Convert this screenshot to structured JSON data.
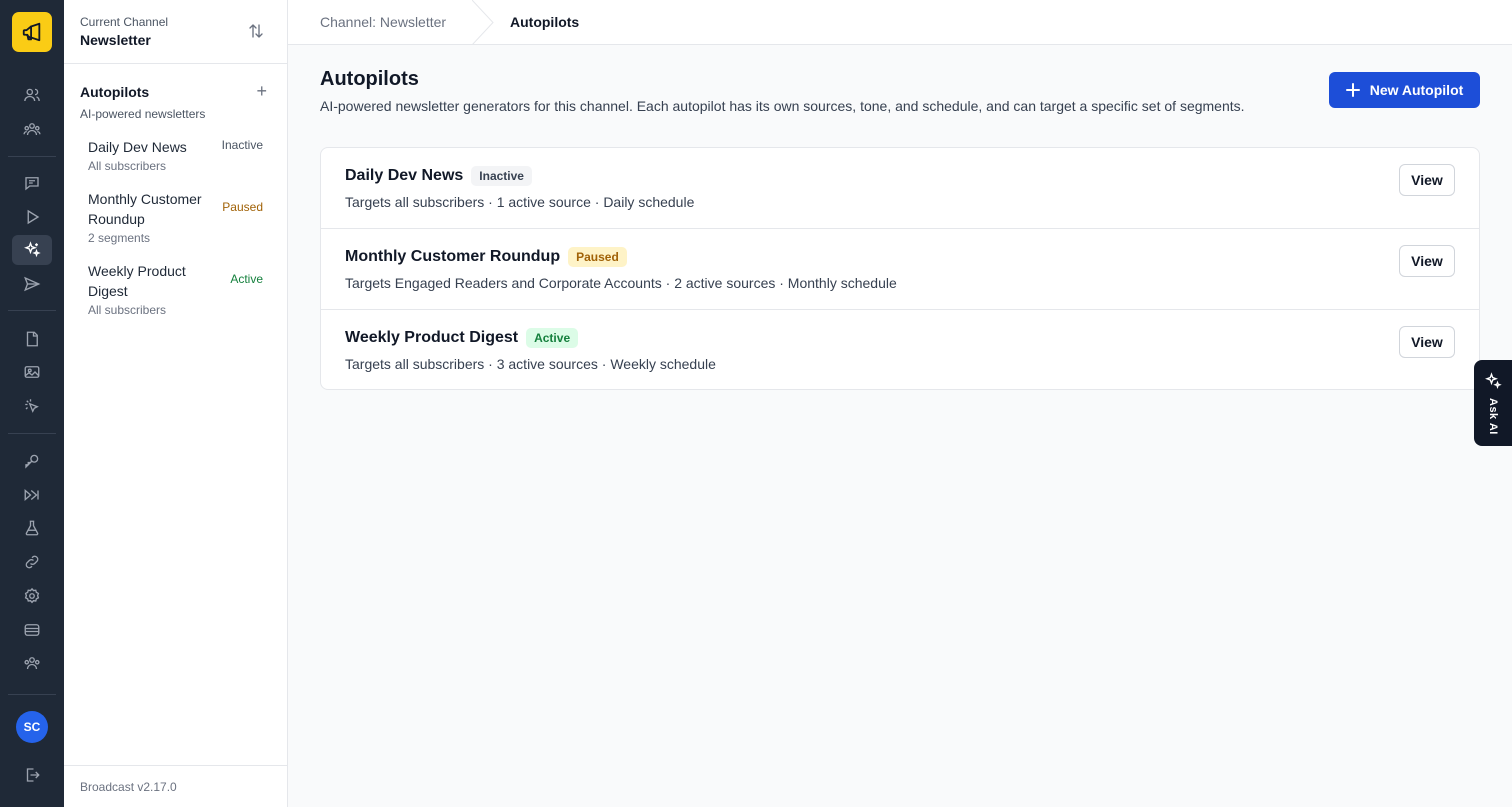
{
  "rail": {
    "logo_icon": "megaphone-icon",
    "avatar_initials": "SC",
    "icons": [
      "subscribers-icon",
      "segments-icon",
      "broadcasts-icon",
      "sequences-icon",
      "autopilots-icon",
      "transactional-icon",
      "templates-icon",
      "media-icon",
      "tracking-icon",
      "api-keys-icon",
      "webhooks-icon",
      "lab-icon",
      "integrations-icon",
      "settings-icon",
      "database-icon",
      "users-icon",
      "logout-icon"
    ]
  },
  "sidebar": {
    "channel_label": "Current Channel",
    "channel_name": "Newsletter",
    "section_title": "Autopilots",
    "section_subtitle": "AI-powered newsletters",
    "items": [
      {
        "name": "Daily Dev News",
        "meta": "All subscribers",
        "status": "Inactive"
      },
      {
        "name": "Monthly Customer Roundup",
        "meta": "2 segments",
        "status": "Paused"
      },
      {
        "name": "Weekly Product Digest",
        "meta": "All subscribers",
        "status": "Active"
      }
    ],
    "version": "Broadcast v2.17.0"
  },
  "breadcrumb": {
    "parent": "Channel: Newsletter",
    "current": "Autopilots"
  },
  "main": {
    "title": "Autopilots",
    "description": "AI-powered newsletter generators for this channel. Each autopilot has its own sources, tone, and schedule, and can target a specific set of segments.",
    "new_button_label": "New Autopilot",
    "view_label": "View",
    "autopilots": [
      {
        "name": "Daily Dev News",
        "status": "Inactive",
        "meta": "Targets all subscribers · 1 active source · Daily schedule"
      },
      {
        "name": "Monthly Customer Roundup",
        "status": "Paused",
        "meta": "Targets Engaged Readers and Corporate Accounts · 2 active sources · Monthly schedule"
      },
      {
        "name": "Weekly Product Digest",
        "status": "Active",
        "meta": "Targets all subscribers · 3 active sources · Weekly schedule"
      }
    ]
  },
  "ask_ai": {
    "label": "Ask AI"
  },
  "colors": {
    "primary": "#1d4ed8",
    "logo": "#facc15",
    "rail": "#1f2937",
    "status_inactive_text": "#374151",
    "status_inactive_bg": "#f3f4f6",
    "status_paused_text": "#a16207",
    "status_paused_bg": "#fef3c7",
    "status_active_text": "#15803d",
    "status_active_bg": "#dcfce7"
  }
}
